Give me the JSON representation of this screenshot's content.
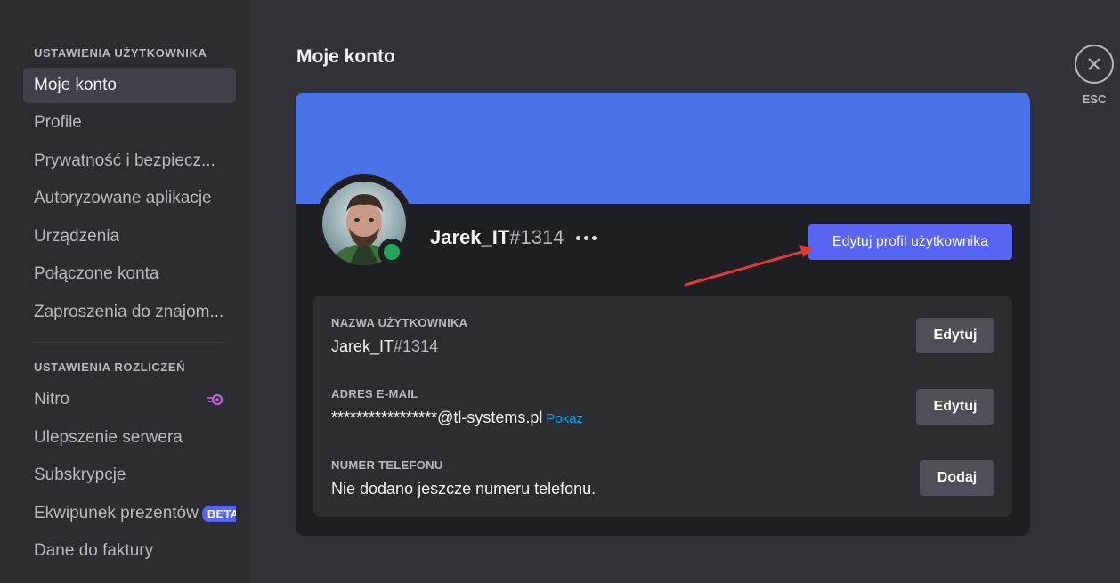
{
  "sidebar": {
    "user_settings_header": "USTAWIENIA UŻYTKOWNIKA",
    "user_items": [
      {
        "label": "Moje konto"
      },
      {
        "label": "Profile"
      },
      {
        "label": "Prywatność i bezpiecz..."
      },
      {
        "label": "Autoryzowane aplikacje"
      },
      {
        "label": "Urządzenia"
      },
      {
        "label": "Połączone konta"
      },
      {
        "label": "Zaproszenia do znajom..."
      }
    ],
    "billing_header": "USTAWIENIA ROZLICZEŃ",
    "billing_items": [
      {
        "label": "Nitro"
      },
      {
        "label": "Ulepszenie serwera"
      },
      {
        "label": "Subskrypcje"
      },
      {
        "label": "Ekwipunek prezentów",
        "badge": "BETA"
      },
      {
        "label": "Dane do faktury"
      }
    ]
  },
  "main": {
    "title": "Moje konto",
    "close_label": "ESC"
  },
  "profile": {
    "name": "Jarek_IT",
    "tag": "#1314",
    "edit_profile_label": "Edytuj profil użytkownika"
  },
  "fields": {
    "username_label": "NAZWA UŻYTKOWNIKA",
    "username_name": "Jarek_IT",
    "username_tag": "#1314",
    "username_button": "Edytuj",
    "email_label": "ADRES E-MAIL",
    "email_value": "*****************@tl-systems.pl",
    "email_show": "Pokaż",
    "email_button": "Edytuj",
    "phone_label": "NUMER TELEFONU",
    "phone_value": "Nie dodano jeszcze numeru telefonu.",
    "phone_button": "Dodaj"
  },
  "colors": {
    "banner": "#4b73e8",
    "accent": "#5865f2",
    "status_online": "#23a55a",
    "annotation_arrow": "#e03a3a"
  }
}
